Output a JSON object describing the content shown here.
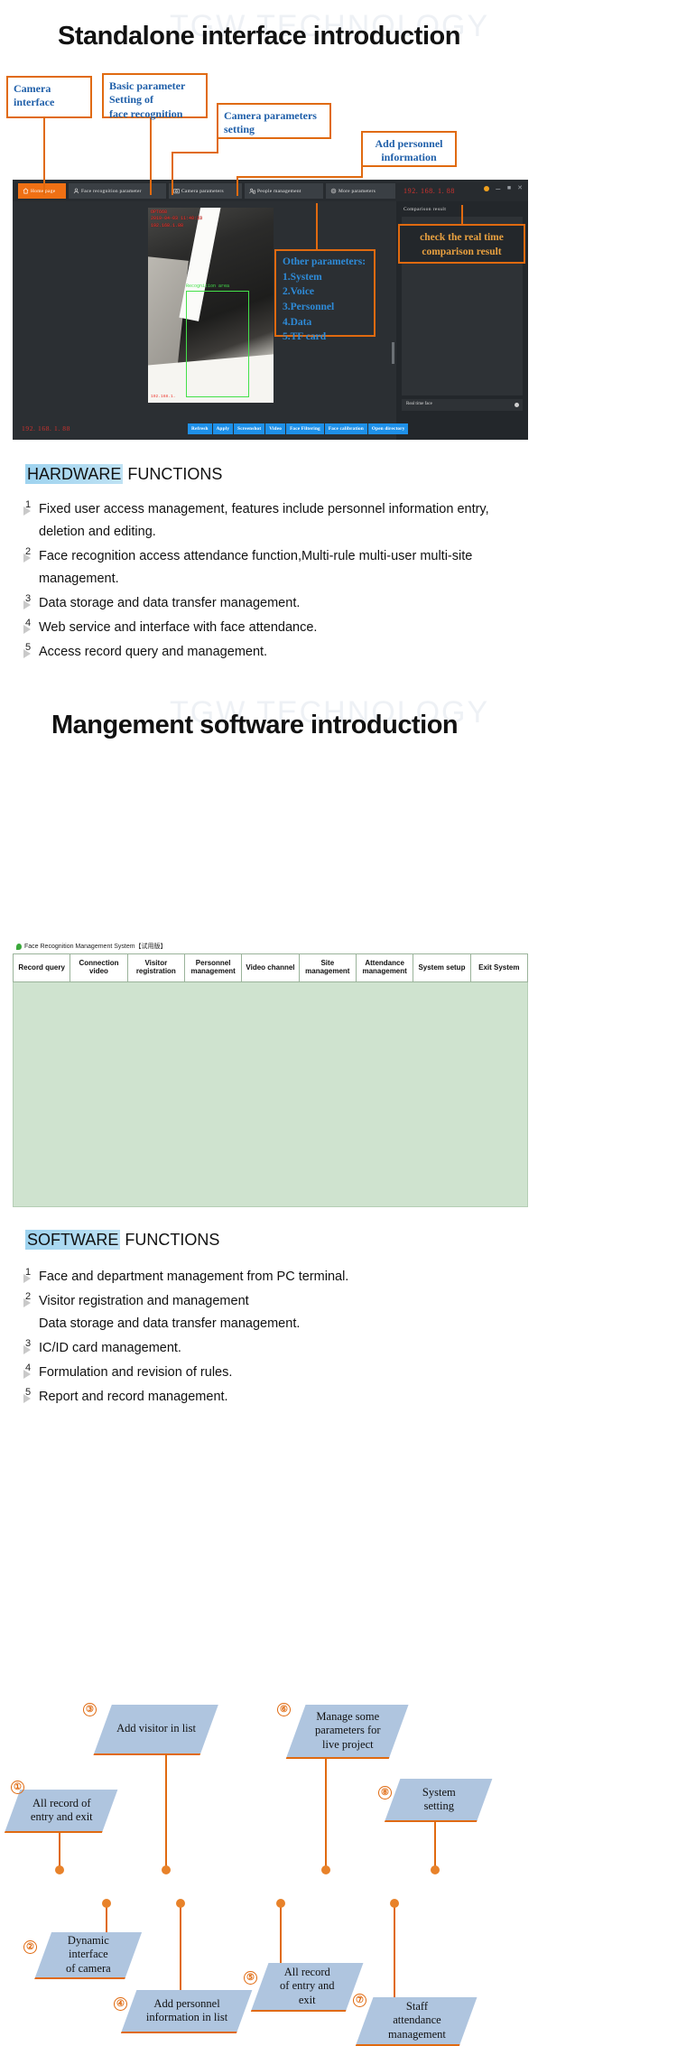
{
  "watermark": "TGW TECHNOLOGY",
  "section1": {
    "title": "Standalone interface introduction",
    "callouts": [
      {
        "id": "camera-interface",
        "text": "Camera\ninterface"
      },
      {
        "id": "basic-parameter",
        "text": "Basic parameter\nSetting of\nface recognition"
      },
      {
        "id": "camera-parameters-setting",
        "text": "Camera parameters\nsetting"
      },
      {
        "id": "add-personnel-information",
        "text": "Add personnel\ninformation"
      },
      {
        "id": "other-parameters",
        "text": "Other parameters:\n1.System\n2.Voice\n3.Personnel\n4.Data\n5.TF card"
      },
      {
        "id": "comparison-result",
        "text": "check the real time\ncomparison result"
      }
    ],
    "app": {
      "tabs": [
        {
          "label": "Home page",
          "icon": "home-icon",
          "active": true
        },
        {
          "label": "Face recognition parameter",
          "icon": "face-icon",
          "active": false
        },
        {
          "label": "Camera parameters",
          "icon": "camera-icon",
          "active": false
        },
        {
          "label": "People management",
          "icon": "people-icon",
          "active": false
        },
        {
          "label": "More parameters",
          "icon": "gear-icon",
          "active": false
        }
      ],
      "ip": "192. 168. 1. 88",
      "ip_bottom": "192. 168. 1. 88",
      "comparison_title": "Comparison result",
      "realtime_label": "Real time face",
      "osd_lines": [
        "OPT668",
        "2019-04-03  11:40:33",
        "192.168.1.88"
      ],
      "osd_bottom": "192.168.1.",
      "face_box_label": "Recognition area",
      "buttons": [
        "Refresh",
        "Apply",
        "Screenshot",
        "Video",
        "Face Filtering",
        "Face calibration",
        "Open directory"
      ],
      "window_controls": [
        "minimize",
        "maximize",
        "close"
      ]
    }
  },
  "hardware": {
    "heading_highlight": "HARDWARE",
    "heading_rest": " FUNCTIONS",
    "items": [
      {
        "n": "1",
        "text": "Fixed user access management, features include personnel information entry, deletion and editing."
      },
      {
        "n": "2",
        "text": "Face recognition access attendance function,Multi-rule multi-user multi-site management."
      },
      {
        "n": "3",
        "text": "Data storage and data transfer management."
      },
      {
        "n": "4",
        "text": "Web service and interface with face attendance."
      },
      {
        "n": "5",
        "text": "Access record query and management."
      }
    ]
  },
  "section2": {
    "title": "Mangement software introduction",
    "software": {
      "window_title": "Face Recognition Management System【试用版】",
      "menu": [
        "Record query",
        "Connection video",
        "Visitor registration",
        "Personnel management",
        "Video channel",
        "Site management",
        "Attendance management",
        "System setup",
        "Exit System"
      ]
    },
    "annotations": [
      {
        "num": "①",
        "text": "All record of\nentry and exit"
      },
      {
        "num": "②",
        "text": "Dynamic\ninterface\nof camera"
      },
      {
        "num": "③",
        "text": "Add visitor in list"
      },
      {
        "num": "④",
        "text": "Add personnel\ninformation in list"
      },
      {
        "num": "⑤",
        "text": "All record\nof entry and\nexit"
      },
      {
        "num": "⑥",
        "text": "Manage some\nparameters for\nlive project"
      },
      {
        "num": "⑦",
        "text": "Staff\nattendance\nmanagement"
      },
      {
        "num": "⑧",
        "text": "System\nsetting"
      }
    ]
  },
  "software_functions": {
    "heading_highlight": "SOFTWARE",
    "heading_rest": " FUNCTIONS",
    "items": [
      {
        "n": "1",
        "text": "Face and department management from PC terminal."
      },
      {
        "n": "2",
        "text": "Visitor registration and management\nData storage and data transfer management."
      },
      {
        "n": "3",
        "text": "IC/ID card management."
      },
      {
        "n": "4",
        "text": "Formulation and revision of rules."
      },
      {
        "n": "5",
        "text": "Report and record management."
      }
    ]
  },
  "colors": {
    "orange": "#E06A10",
    "callout_text": "#1F5FA9",
    "app_bg": "#2b2f33",
    "tab_active": "#F07014",
    "button_blue": "#1E90E8",
    "parallelogram": "#AFC5DF",
    "software_body": "#CFE3CF",
    "highlight": "#9ed3ef"
  }
}
